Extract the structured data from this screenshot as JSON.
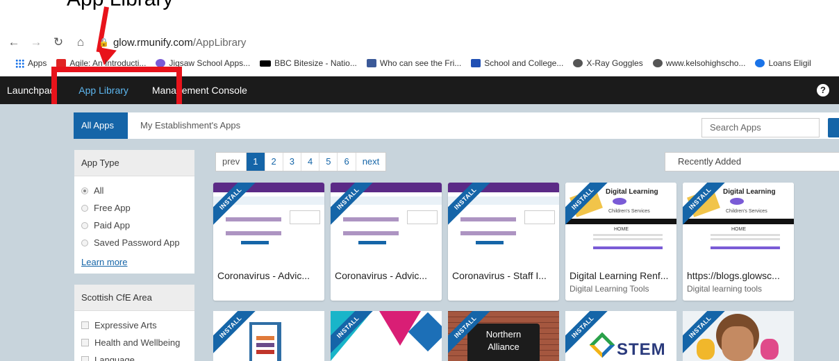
{
  "annotation": {
    "text": "App Library"
  },
  "browser": {
    "url_host": "glow.rmunify.com",
    "url_path": "/AppLibrary",
    "bookmarks": [
      {
        "label": "Apps",
        "color": "#1a73e8"
      },
      {
        "label": "Agile: An Introducti...",
        "color": "#e02424"
      },
      {
        "label": "Jigsaw School Apps...",
        "color": "#7a5bd6"
      },
      {
        "label": "BBC Bitesize - Natio...",
        "color": "#000000"
      },
      {
        "label": "Who can see the Fri...",
        "color": "#3b5998"
      },
      {
        "label": "School and College...",
        "color": "#1f4fb4"
      },
      {
        "label": "X-Ray Goggles",
        "color": "#555555"
      },
      {
        "label": "www.kelsohighscho...",
        "color": "#555555"
      },
      {
        "label": "Loans Eligil",
        "color": "#1a73e8"
      }
    ]
  },
  "topnav": {
    "items": [
      "Launchpad",
      "App Library",
      "Management Console"
    ]
  },
  "tabs": {
    "all": "All Apps",
    "mine": "My Establishment's Apps"
  },
  "search": {
    "placeholder": "Search Apps"
  },
  "filters": {
    "app_type": {
      "title": "App Type",
      "options": [
        "All",
        "Free App",
        "Paid App",
        "Saved Password App"
      ],
      "learn_more": "Learn more"
    },
    "cfe": {
      "title": "Scottish CfE Area",
      "options": [
        "Expressive Arts",
        "Health and Wellbeing",
        "Language"
      ]
    }
  },
  "pager": {
    "prev": "prev",
    "pages": [
      "1",
      "2",
      "3",
      "4",
      "5",
      "6"
    ],
    "next": "next"
  },
  "sort": {
    "selected": "Recently Added"
  },
  "ribbon": "INSTALL",
  "cards": [
    {
      "title": "Coronavirus - Advic...",
      "subtitle": ""
    },
    {
      "title": "Coronavirus - Advic...",
      "subtitle": ""
    },
    {
      "title": "Coronavirus - Staff I...",
      "subtitle": ""
    },
    {
      "title": "Digital Learning Renf...",
      "subtitle": "Digital Learning Tools"
    },
    {
      "title": "https://blogs.glowsc...",
      "subtitle": "Digital learning tools"
    }
  ],
  "row2": {
    "northern_text": "Northern",
    "northern_text2": "Alliance",
    "stem": "STEM"
  },
  "thumb_dl": {
    "heading": "Digital Learning",
    "sub": "Children's Services",
    "home": "HOME"
  },
  "colors": {
    "accent": "#1565a8",
    "header_bg": "#1b1b1b",
    "annotation_red": "#e8131b"
  }
}
